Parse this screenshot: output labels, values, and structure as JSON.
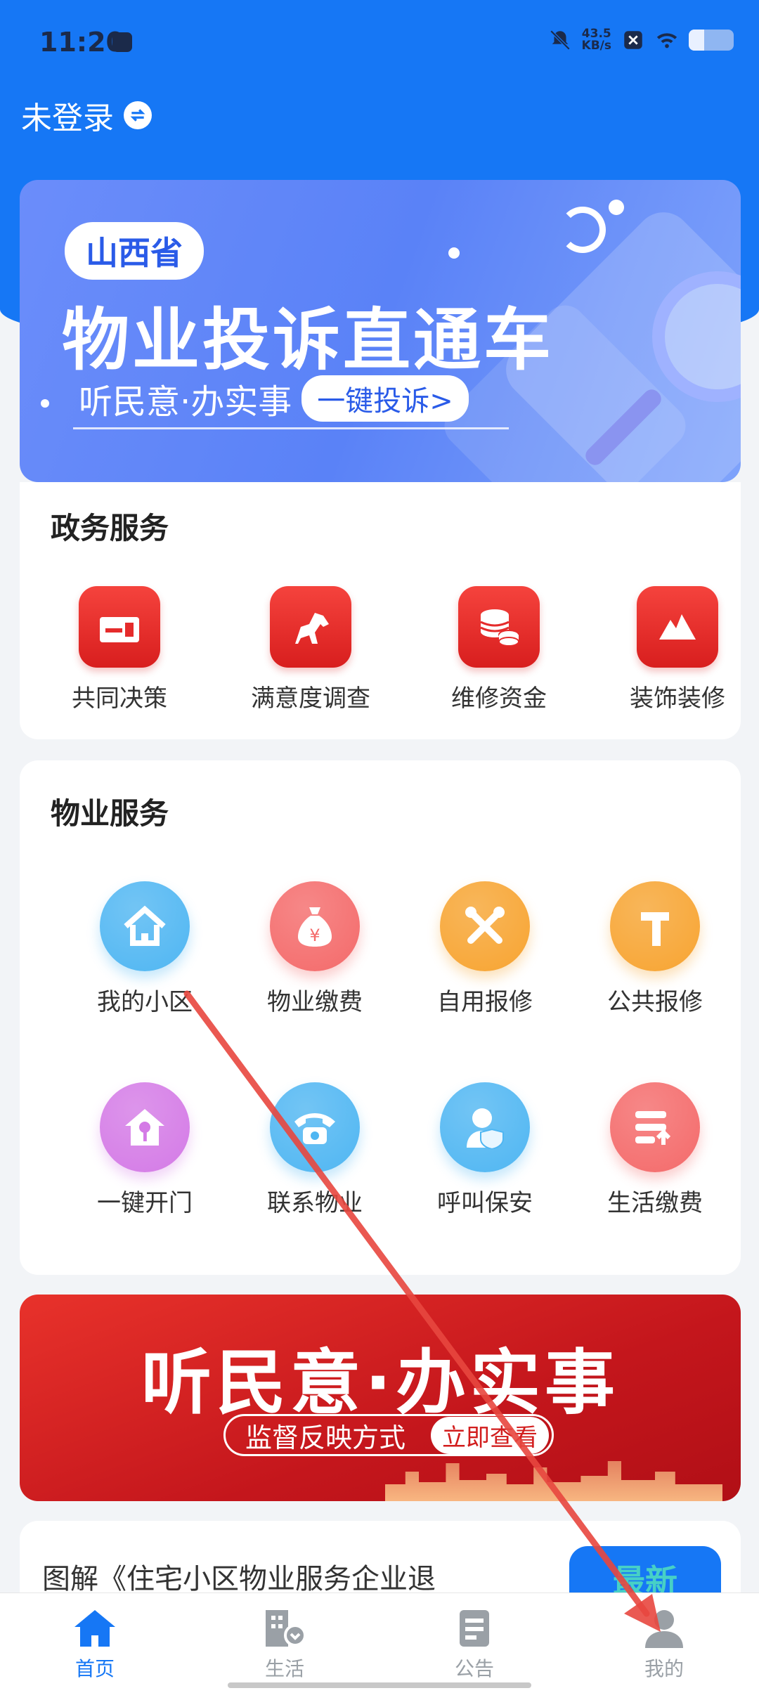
{
  "status_bar": {
    "time": "11:20",
    "net_speed_value": "43.5",
    "net_speed_unit": "KB/s",
    "battery_level": 0.35
  },
  "header": {
    "login_text": "未登录"
  },
  "banner_top": {
    "tag": "山西省",
    "title": "物业投诉直通车",
    "subtitle": "听民意·办实事",
    "button": "一键投诉>"
  },
  "gov_services": {
    "title": "政务服务",
    "items": [
      {
        "label": "共同决策",
        "icon": "ballot-icon"
      },
      {
        "label": "满意度调查",
        "icon": "horse-icon"
      },
      {
        "label": "维修资金",
        "icon": "coins-icon"
      },
      {
        "label": "装饰装修",
        "icon": "mountain-icon"
      }
    ]
  },
  "property_services": {
    "title": "物业服务",
    "items": [
      {
        "label": "我的小区",
        "icon": "house-icon",
        "color": "#4fb6f2"
      },
      {
        "label": "物业缴费",
        "icon": "money-bag-icon",
        "color": "#f46a6a"
      },
      {
        "label": "自用报修",
        "icon": "tools-icon",
        "color": "#f7a431"
      },
      {
        "label": "公共报修",
        "icon": "hammer-icon",
        "color": "#f7a431"
      },
      {
        "label": "一键开门",
        "icon": "key-house-icon",
        "color": "#d47ae6"
      },
      {
        "label": "联系物业",
        "icon": "phone-icon",
        "color": "#4fb6f2"
      },
      {
        "label": "呼叫保安",
        "icon": "security-guard-icon",
        "color": "#4fb6f2"
      },
      {
        "label": "生活缴费",
        "icon": "bill-icon",
        "color": "#f46a6a"
      }
    ]
  },
  "banner_red": {
    "title": "听民意·办实事",
    "pill_text": "监督反映方式",
    "button": "立即查看"
  },
  "news": {
    "text": "图解《住宅小区物业服务企业退",
    "badge": "最新"
  },
  "tabbar": {
    "tabs": [
      {
        "label": "首页",
        "icon": "home-icon",
        "active": true
      },
      {
        "label": "生活",
        "icon": "building-icon",
        "active": false
      },
      {
        "label": "公告",
        "icon": "notice-icon",
        "active": false
      },
      {
        "label": "我的",
        "icon": "person-icon",
        "active": false
      }
    ]
  },
  "colors": {
    "primary": "#1677f5",
    "gov_red": "#e52b2b",
    "annotation_arrow": "#e8473f"
  }
}
